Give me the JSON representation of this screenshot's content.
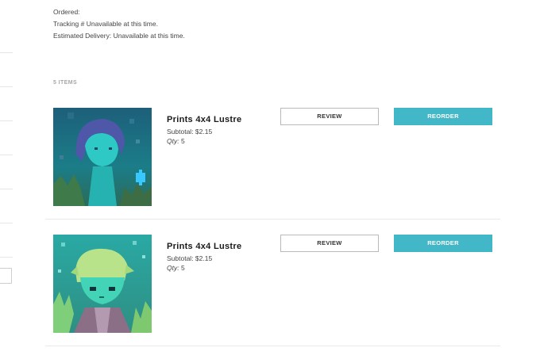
{
  "order": {
    "ordered_label": "Ordered:",
    "tracking_label": "Tracking # Unavailable at this time.",
    "delivery_label": "Estimated Delivery: Unavailable at this time."
  },
  "items_count": "5 ITEMS",
  "items": [
    {
      "title": "Prints 4x4 Lustre",
      "subtotal": "Subtotal: $2.15",
      "qty_label": "Qty:",
      "qty_value": "5",
      "review_label": "REVIEW",
      "reorder_label": "REORDER"
    },
    {
      "title": "Prints 4x4 Lustre",
      "subtotal": "Subtotal: $2.15",
      "qty_label": "Qty:",
      "qty_value": "5",
      "review_label": "REVIEW",
      "reorder_label": "REORDER"
    }
  ],
  "colors": {
    "accent": "#41b7c7",
    "divider": "#e9e9e9"
  }
}
